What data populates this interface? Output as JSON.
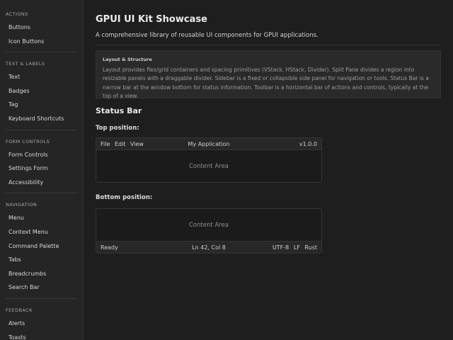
{
  "sidebar": {
    "sections": [
      {
        "title": "ACTIONS",
        "items": [
          "Buttons",
          "Icon Buttons"
        ]
      },
      {
        "title": "TEXT & LABELS",
        "items": [
          "Text",
          "Badges",
          "Tag",
          "Keyboard Shortcuts"
        ]
      },
      {
        "title": "FORM CONTROLS",
        "items": [
          "Form Controls",
          "Settings Form",
          "Accessibility"
        ]
      },
      {
        "title": "NAVIGATION",
        "items": [
          "Menu",
          "Context Menu",
          "Command Palette",
          "Tabs",
          "Breadcrumbs",
          "Search Bar"
        ]
      },
      {
        "title": "FEEDBACK",
        "items": [
          "Alerts",
          "Toasts"
        ]
      }
    ]
  },
  "main": {
    "title": "GPUI UI Kit Showcase",
    "subtitle": "A comprehensive library of reusable UI components for GPUI applications.",
    "info": {
      "title": "Layout & Structure",
      "body": "Layout provides flex/grid containers and spacing primitives (VStack, HStack, Divider). Split Pane divides a region into resizable panels with a draggable divider. Sidebar is a fixed or collapsible side panel for navigation or tools. Status Bar is a narrow bar at the window bottom for status information. Toolbar is a horizontal bar of actions and controls, typically at the top of a view."
    },
    "section_title": "Status Bar",
    "top": {
      "label": "Top position:",
      "left": [
        "File",
        "Edit",
        "View"
      ],
      "center": "My Application",
      "right": [
        "v1.0.0"
      ],
      "content": "Content Area"
    },
    "bottom": {
      "label": "Bottom position:",
      "left": [
        "Ready"
      ],
      "center": "Ln 42, Col 8",
      "right": [
        "UTF-8",
        "LF",
        "Rust"
      ],
      "content": "Content Area"
    }
  }
}
